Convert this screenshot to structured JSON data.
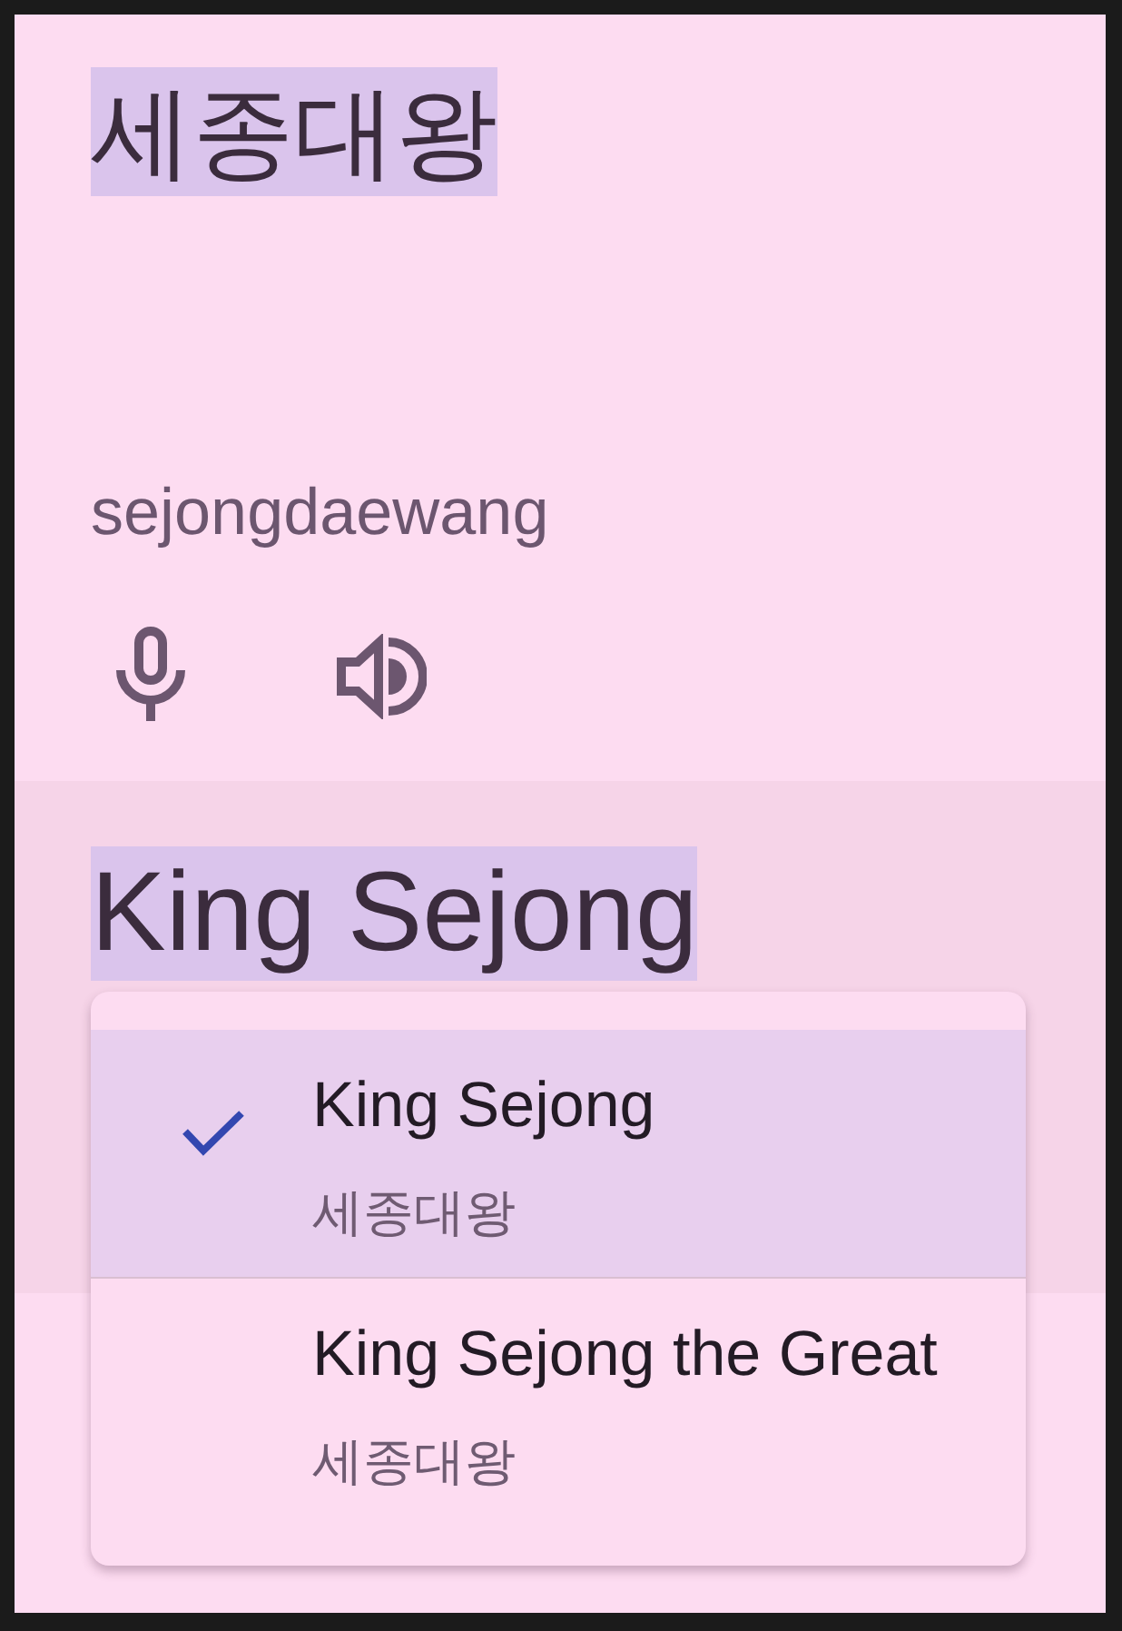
{
  "source": {
    "text": "세종대왕",
    "highlighted": true,
    "romanization": "sejongdaewang"
  },
  "translation": {
    "text": "King Sejong",
    "highlighted": true
  },
  "menu": {
    "items": [
      {
        "title": "King Sejong",
        "subtitle": "세종대왕",
        "selected": true
      },
      {
        "title": "King Sejong the Great",
        "subtitle": "세종대왕",
        "selected": false
      }
    ]
  }
}
